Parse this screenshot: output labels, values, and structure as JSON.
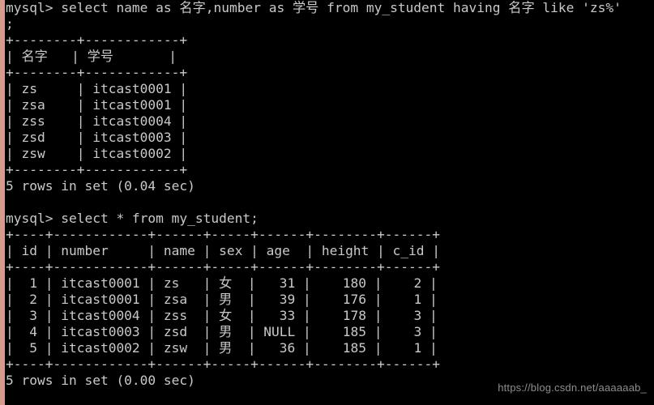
{
  "terminal": {
    "background_color": "#000000",
    "text_color": "#c9c9c9",
    "accent_bar_color": "#d79b8e",
    "prompt": "mysql>",
    "lines": [
      "mysql> select name as 名字,number as 学号 from my_student having 名字 like 'zs%'",
      ";",
      "+--------+------------+",
      "| 名字   | 学号       |",
      "+--------+------------+",
      "| zs     | itcast0001 |",
      "| zsa    | itcast0001 |",
      "| zss    | itcast0004 |",
      "| zsd    | itcast0003 |",
      "| zsw    | itcast0002 |",
      "+--------+------------+",
      "5 rows in set (0.04 sec)",
      "",
      "mysql> select * from my_student;",
      "+----+------------+------+-----+------+--------+------+",
      "| id | number     | name | sex | age  | height | c_id |",
      "+----+------------+------+-----+------+--------+------+",
      "|  1 | itcast0001 | zs   | 女  |   31 |    180 |    2 |",
      "|  2 | itcast0001 | zsa  | 男  |   39 |    176 |    1 |",
      "|  3 | itcast0004 | zss  | 女  |   33 |    178 |    3 |",
      "|  4 | itcast0003 | zsd  | 男  | NULL |    185 |    3 |",
      "|  5 | itcast0002 | zsw  | 男  |   36 |    185 |    1 |",
      "+----+------------+------+-----+------+--------+------+",
      "5 rows in set (0.00 sec)"
    ],
    "query_1": {
      "sql": "select name as 名字,number as 学号 from my_student having 名字 like 'zs%';",
      "columns": [
        "名字",
        "学号"
      ],
      "rows": [
        [
          "zs",
          "itcast0001"
        ],
        [
          "zsa",
          "itcast0001"
        ],
        [
          "zss",
          "itcast0004"
        ],
        [
          "zsd",
          "itcast0003"
        ],
        [
          "zsw",
          "itcast0002"
        ]
      ],
      "status": "5 rows in set (0.04 sec)"
    },
    "query_2": {
      "sql": "select * from my_student;",
      "columns": [
        "id",
        "number",
        "name",
        "sex",
        "age",
        "height",
        "c_id"
      ],
      "rows": [
        [
          "1",
          "itcast0001",
          "zs",
          "女",
          "31",
          "180",
          "2"
        ],
        [
          "2",
          "itcast0001",
          "zsa",
          "男",
          "39",
          "176",
          "1"
        ],
        [
          "3",
          "itcast0004",
          "zss",
          "女",
          "33",
          "178",
          "3"
        ],
        [
          "4",
          "itcast0003",
          "zsd",
          "男",
          "NULL",
          "185",
          "3"
        ],
        [
          "5",
          "itcast0002",
          "zsw",
          "男",
          "36",
          "185",
          "1"
        ]
      ],
      "status": "5 rows in set (0.00 sec)"
    }
  },
  "watermark": {
    "text": "https://blog.csdn.net/aaaaaab_"
  }
}
